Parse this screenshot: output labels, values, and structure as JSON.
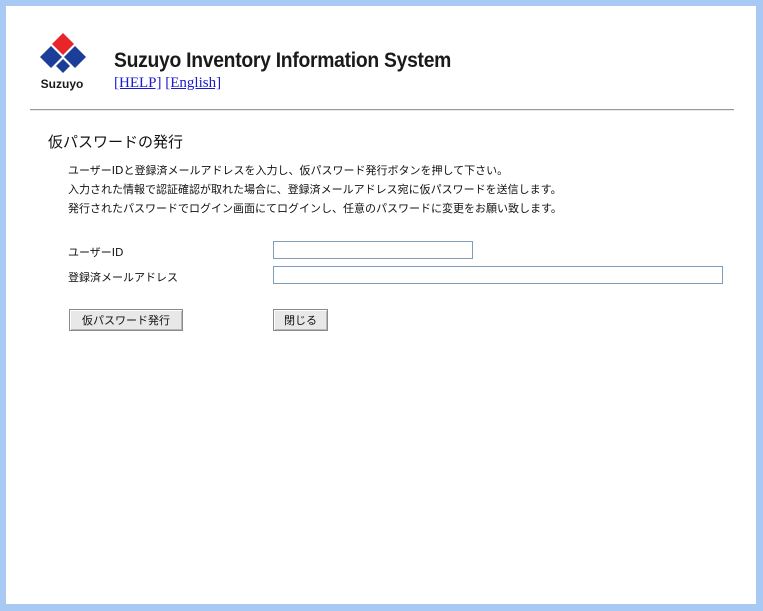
{
  "header": {
    "logo_text": "Suzuyo",
    "system_title": "Suzuyo Inventory Information System",
    "help_link": "[HELP]",
    "english_link": "[English]"
  },
  "page": {
    "title": "仮パスワードの発行",
    "description": [
      "ユーザーIDと登録済メールアドレスを入力し、仮パスワード発行ボタンを押して下さい。",
      "入力された情報で認証確認が取れた場合に、登録済メールアドレス宛に仮パスワードを送信します。",
      "発行されたパスワードでログイン画面にてログインし、任意のパスワードに変更をお願い致します。"
    ]
  },
  "form": {
    "user_id_label": "ユーザーID",
    "user_id_value": "",
    "email_label": "登録済メールアドレス",
    "email_value": ""
  },
  "buttons": {
    "issue_label": "仮パスワード発行",
    "close_label": "閉じる"
  },
  "colors": {
    "logo_red": "#e8262a",
    "logo_blue": "#1b3f99",
    "page_background": "#a9c9f5"
  }
}
